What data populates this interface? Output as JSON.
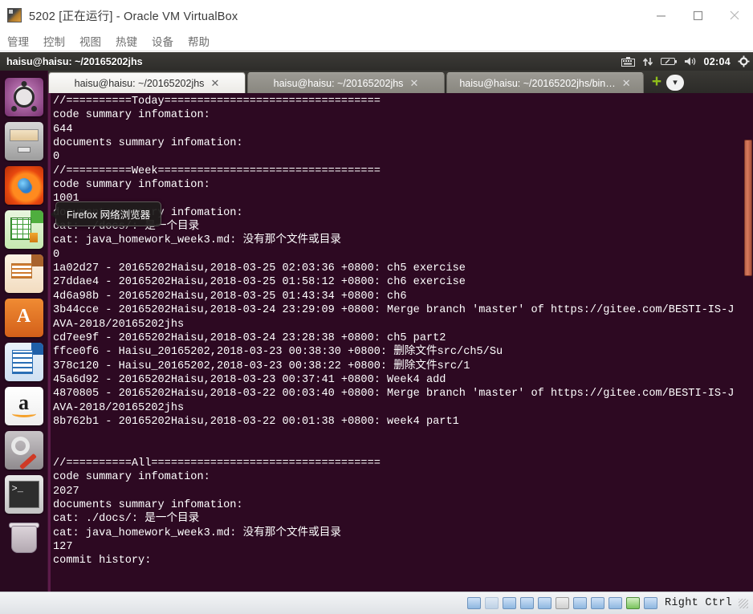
{
  "host_window": {
    "title": "5202 [正在运行] - Oracle VM VirtualBox",
    "app_icon": "virtualbox-icon",
    "menu": [
      {
        "label": "管理"
      },
      {
        "label": "控制"
      },
      {
        "label": "视图"
      },
      {
        "label": "热键"
      },
      {
        "label": "设备"
      },
      {
        "label": "帮助"
      }
    ],
    "controls": {
      "minimize": "minimize",
      "maximize": "maximize",
      "close": "close"
    }
  },
  "guest": {
    "top_panel": {
      "title": "haisu@haisu: ~/20165202jhs",
      "indicators": [
        {
          "name": "keyboard-indicator-icon",
          "glyph": "⌨"
        },
        {
          "name": "network-indicator-icon",
          "glyph": "⇅"
        },
        {
          "name": "battery-indicator-icon",
          "glyph": "▭"
        },
        {
          "name": "volume-indicator-icon",
          "glyph": "🔊"
        }
      ],
      "clock": "02:04",
      "session_menu_icon": "power-gear-icon"
    },
    "launcher": {
      "items": [
        {
          "name": "dash-home",
          "label": "Ubuntu Dash 主页"
        },
        {
          "name": "files",
          "label": "文件管理器"
        },
        {
          "name": "firefox",
          "label": "Firefox 网络浏览器"
        },
        {
          "name": "libreoffice-calc",
          "label": "LibreOffice Calc"
        },
        {
          "name": "libreoffice-impress",
          "label": "LibreOffice Impress"
        },
        {
          "name": "ubuntu-software",
          "label": "Ubuntu 软件中心"
        },
        {
          "name": "libreoffice-writer",
          "label": "LibreOffice Writer"
        },
        {
          "name": "amazon",
          "label": "Amazon"
        },
        {
          "name": "system-settings",
          "label": "系统设置"
        },
        {
          "name": "terminal",
          "label": "终端",
          "active": true
        },
        {
          "name": "trash",
          "label": "回收站"
        }
      ]
    },
    "tooltip": {
      "text": "Firefox 网络浏览器"
    },
    "terminal": {
      "tabs": [
        {
          "label": "haisu@haisu: ~/20165202jhs",
          "active": true
        },
        {
          "label": "haisu@haisu: ~/20165202jhs",
          "active": false
        },
        {
          "label": "haisu@haisu: ~/20165202jhs/bin…",
          "active": false
        }
      ],
      "new_tab_label": "+",
      "tab_list_label": "▾",
      "output": "//==========Today=================================\ncode summary infomation:\n644\ndocuments summary infomation:\n0\n//==========Week==================================\ncode summary infomation:\n1001\ndocuments summary infomation:\ncat: ./docs/: 是一个目录\ncat: java_homework_week3.md: 没有那个文件或目录\n0\n1a02d27 - 20165202Haisu,2018-03-25 02:03:36 +0800: ch5 exercise\n27ddae4 - 20165202Haisu,2018-03-25 01:58:12 +0800: ch6 exercise\n4d6a98b - 20165202Haisu,2018-03-25 01:43:34 +0800: ch6\n3b44cce - 20165202Haisu,2018-03-24 23:29:09 +0800: Merge branch 'master' of https://gitee.com/BESTI-IS-JAVA-2018/20165202jhs\ncd7ee9f - 20165202Haisu,2018-03-24 23:28:38 +0800: ch5 part2\nffce0f6 - Haisu_20165202,2018-03-23 00:38:30 +0800: 删除文件src/ch5/Su\n378c120 - Haisu_20165202,2018-03-23 00:38:22 +0800: 删除文件src/1\n45a6d92 - 20165202Haisu,2018-03-23 00:37:41 +0800: Week4 add\n4870805 - 20165202Haisu,2018-03-22 00:03:40 +0800: Merge branch 'master' of https://gitee.com/BESTI-IS-JAVA-2018/20165202jhs\n8b762b1 - 20165202Haisu,2018-03-22 00:01:38 +0800: week4 part1\n\n\n//==========All===================================\ncode summary infomation:\n2027\ndocuments summary infomation:\ncat: ./docs/: 是一个目录\ncat: java_homework_week3.md: 没有那个文件或目录\n127\ncommit history:"
    }
  },
  "status_bar": {
    "icons": [
      {
        "name": "hard-disk-icon"
      },
      {
        "name": "optical-drive-icon"
      },
      {
        "name": "audio-icon"
      },
      {
        "name": "network-adapter-icon"
      },
      {
        "name": "usb-icon"
      },
      {
        "name": "shared-folders-icon"
      },
      {
        "name": "display-icon"
      },
      {
        "name": "recording-icon"
      },
      {
        "name": "virtualization-icon"
      },
      {
        "name": "mouse-integration-icon"
      },
      {
        "name": "host-key-icon"
      }
    ],
    "host_key": "Right Ctrl"
  },
  "colors": {
    "terminal_bg": "#2d0922",
    "terminal_fg": "#ffffff",
    "panel_bg": "#2e2d2a",
    "launcher_bg": "#290b21",
    "accent_orange": "#d97a5c"
  }
}
